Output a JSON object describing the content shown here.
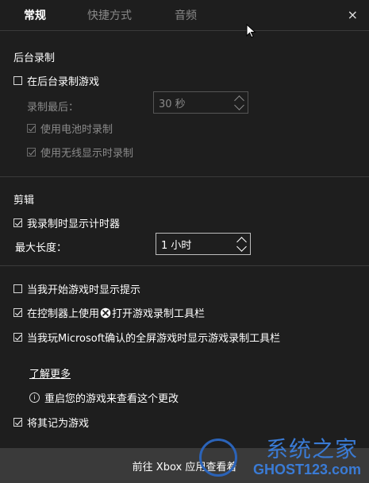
{
  "tabs": {
    "general": "常规",
    "shortcuts": "快捷方式",
    "audio": "音频"
  },
  "close_glyph": "×",
  "bg_recording": {
    "title": "后台录制",
    "record_in_background": "在后台录制游戏",
    "record_last_label": "录制最后：",
    "record_last_value": "30 秒",
    "on_battery": "使用电池时录制",
    "on_wireless_display": "使用无线显示时录制"
  },
  "clips": {
    "title": "剪辑",
    "show_timer": "我录制时显示计时器",
    "max_length_label": "最大长度：",
    "max_length_value": "1 小时"
  },
  "options": {
    "show_tips": "当我开始游戏时显示提示",
    "controller_open": "在控制器上使用",
    "controller_open_tail": "打开游戏录制工具栏",
    "fullscreen_show": "当我玩Microsoft确认的全屏游戏时显示游戏录制工具栏",
    "learn_more": "了解更多",
    "restart_note": "重启您的游戏来查看这个更改",
    "mark_as_game": "将其记为游戏"
  },
  "footer": {
    "text": "前往 Xbox 应用查看着"
  },
  "watermark": {
    "top": "系统之家",
    "bottom": "GHOST123.com"
  },
  "colors": {
    "background": "#1e1e1e",
    "footer": "#3a3a3a",
    "watermark": "#3a7bd5"
  },
  "icons": [
    "close-icon",
    "cursor-icon",
    "xbox-icon",
    "info-icon",
    "spin-up-icon",
    "spin-down-icon"
  ]
}
